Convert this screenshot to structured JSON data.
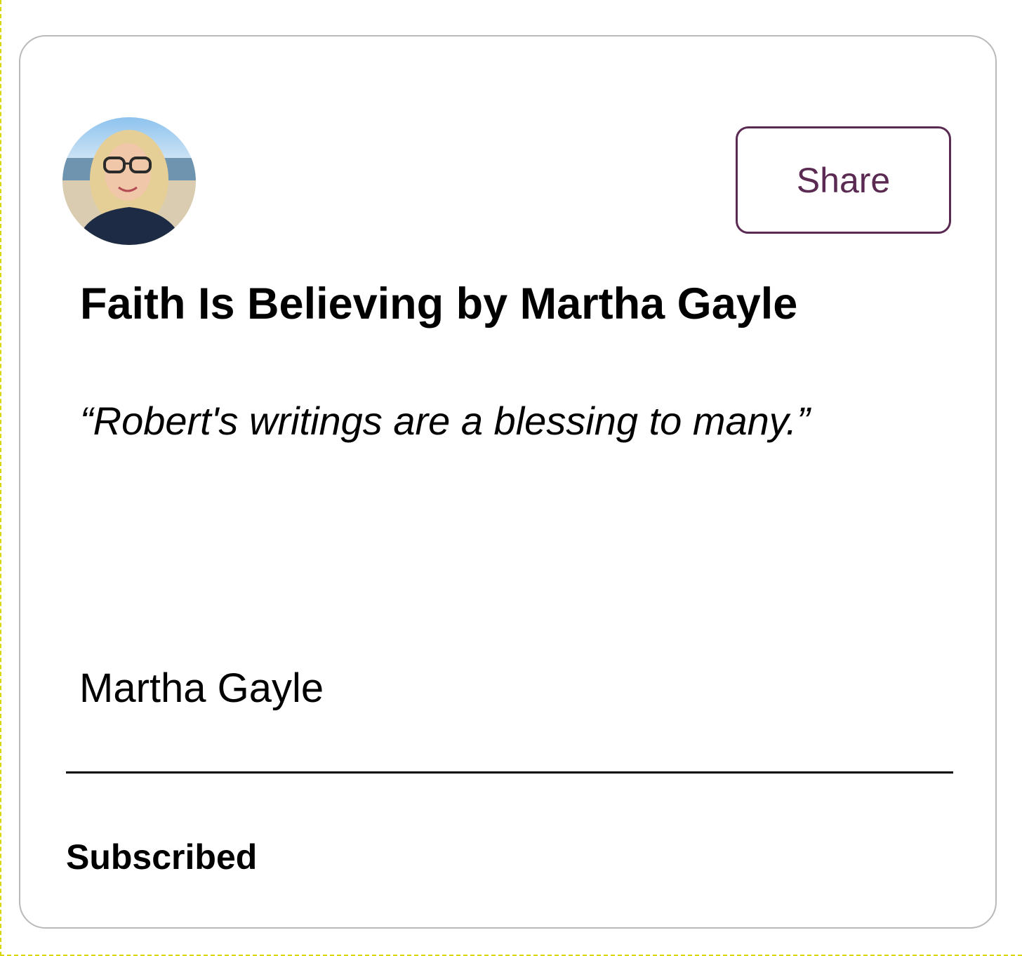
{
  "card": {
    "title": "Faith Is Believing by Martha Gayle",
    "quote": "“Robert's writings are a blessing to many.”",
    "author": "Martha Gayle",
    "share_label": "Share",
    "status": "Subscribed"
  },
  "colors": {
    "accent": "#5a2a52",
    "card_border": "#b9b9b9",
    "text": "#000000"
  },
  "avatar": {
    "icon": "profile-photo"
  }
}
